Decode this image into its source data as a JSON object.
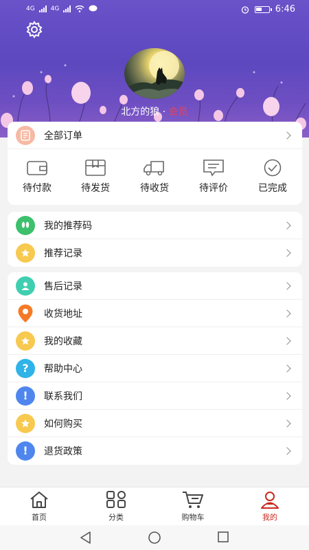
{
  "status_bar": {
    "time": "6:46",
    "network_left": "4G",
    "network_right": "4G"
  },
  "profile": {
    "username": "北方的狼",
    "separator": " · ",
    "member_label": "会员"
  },
  "orders": {
    "all_label": "全部订单",
    "items": [
      {
        "label": "待付款",
        "icon": "wallet-icon"
      },
      {
        "label": "待发货",
        "icon": "package-icon"
      },
      {
        "label": "待收货",
        "icon": "truck-icon"
      },
      {
        "label": "待评价",
        "icon": "comment-icon"
      },
      {
        "label": "已完成",
        "icon": "check-circle-icon"
      }
    ]
  },
  "referral": {
    "items": [
      {
        "label": "我的推荐码",
        "icon": "footprint-icon",
        "color": "#3cc06b"
      },
      {
        "label": "推荐记录",
        "icon": "star-icon",
        "color": "#f7c950"
      }
    ]
  },
  "services": {
    "items": [
      {
        "label": "售后记录",
        "icon": "user-icon",
        "color": "#3fcfb0"
      },
      {
        "label": "收货地址",
        "icon": "location-pin-icon",
        "color": "#f57a26"
      },
      {
        "label": "我的收藏",
        "icon": "star-icon",
        "color": "#f7c950"
      },
      {
        "label": "帮助中心",
        "icon": "question-icon",
        "color": "#2fb3e8"
      },
      {
        "label": "联系我们",
        "icon": "exclamation-icon",
        "color": "#4f86ee"
      },
      {
        "label": "如何购买",
        "icon": "star-icon",
        "color": "#f7c950"
      },
      {
        "label": "退货政策",
        "icon": "exclamation-icon",
        "color": "#4f86ee"
      }
    ]
  },
  "tabbar": {
    "items": [
      {
        "label": "首页",
        "icon": "home-icon"
      },
      {
        "label": "分类",
        "icon": "category-icon"
      },
      {
        "label": "购物车",
        "icon": "cart-icon"
      },
      {
        "label": "我的",
        "icon": "profile-icon",
        "active": true
      }
    ],
    "active_color": "#c9281f"
  },
  "theme": {
    "header_color": "#5d48bf",
    "accent_red": "#e9415b"
  }
}
